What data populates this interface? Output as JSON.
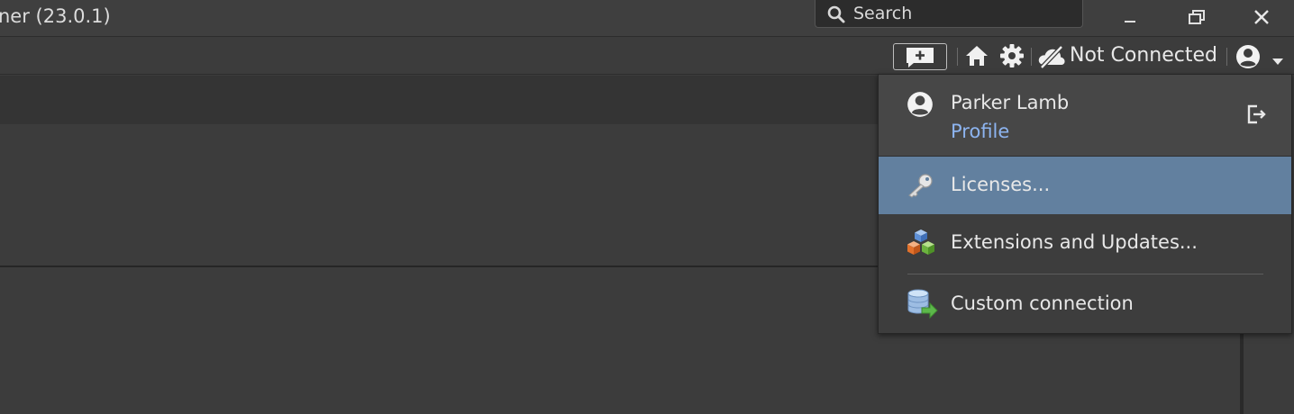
{
  "window": {
    "title": "ner (23.0.1)",
    "controls": [
      "minimize",
      "restore",
      "close"
    ]
  },
  "search": {
    "placeholder": "Search",
    "icon": "search-icon"
  },
  "toolbar": {
    "feedback_icon": "add-comment-icon",
    "home_icon": "home-icon",
    "settings_icon": "gear-icon",
    "connection_icon": "cloud-off-icon",
    "connection_status": "Not Connected",
    "account_icon": "account-circle-icon",
    "account_caret_icon": "caret-down-icon"
  },
  "account_menu": {
    "user": {
      "name": "Parker Lamb",
      "profile_label": "Profile",
      "avatar_icon": "account-circle-icon",
      "sign_out_icon": "sign-out-icon"
    },
    "items": [
      {
        "label": "Licenses...",
        "icon": "key-icon",
        "active": true
      },
      {
        "label": "Extensions and Updates...",
        "icon": "cubes-icon",
        "active": false
      },
      {
        "label": "Custom connection",
        "icon": "database-arrow-icon",
        "active": false
      }
    ]
  },
  "colors": {
    "background": "#3c3c3c",
    "menu_active": "#62809f",
    "link": "#8db4f0"
  }
}
